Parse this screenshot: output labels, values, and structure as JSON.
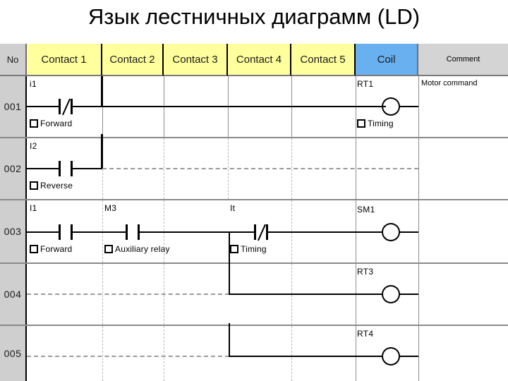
{
  "title": "Язык лестничных диаграмм (LD)",
  "table": {
    "headers": {
      "no": "No",
      "contact1": "Contact 1",
      "contact2": "Contact 2",
      "contact3": "Contact 3",
      "contact4": "Contact 4",
      "contact5": "Contact 5",
      "coil": "Coil",
      "comment": "Comment"
    },
    "header_colors": {
      "no_bg": "#cfcfcf",
      "contact_bg": "#ffff9e",
      "coil_bg": "#68b0f0",
      "comment_bg": "#d4d4d4"
    },
    "rows": [
      {
        "no": "001",
        "elements": [
          {
            "kind": "contact-nc",
            "operand": "i1",
            "caption": "Forward"
          }
        ],
        "coil": {
          "operand": "RT1",
          "caption": "Timing"
        },
        "comment": "Motor command"
      },
      {
        "no": "002",
        "elements": [
          {
            "kind": "contact-no",
            "operand": "I2",
            "caption": "Reverse"
          }
        ],
        "coil": null,
        "comment": ""
      },
      {
        "no": "003",
        "elements": [
          {
            "kind": "contact-no",
            "operand": "I1",
            "caption": "Forward"
          },
          {
            "kind": "contact-no",
            "operand": "M3",
            "caption": "Auxiliary relay"
          },
          {
            "kind": "contact-nc",
            "operand": "It",
            "caption": "Timing"
          }
        ],
        "coil": {
          "operand": "SM1",
          "caption": ""
        },
        "comment": ""
      },
      {
        "no": "004",
        "elements": [],
        "coil": {
          "operand": "RT3",
          "caption": ""
        },
        "comment": ""
      },
      {
        "no": "005",
        "elements": [],
        "coil": {
          "operand": "RT4",
          "caption": ""
        },
        "comment": ""
      }
    ]
  }
}
